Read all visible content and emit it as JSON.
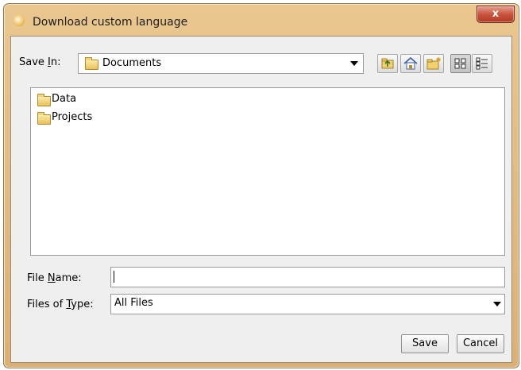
{
  "window": {
    "title": "Download custom language",
    "close_glyph": "x"
  },
  "save_in": {
    "label_prefix": "Save ",
    "label_mnemonic": "I",
    "label_suffix": "n:",
    "selected": "Documents",
    "icon": "folder-icon"
  },
  "toolbar": {
    "buttons": [
      {
        "name": "up-one-level",
        "icon": "folder-up-icon"
      },
      {
        "name": "home",
        "icon": "home-icon"
      },
      {
        "name": "new-folder",
        "icon": "new-folder-icon"
      },
      {
        "name": "list-view",
        "icon": "grid-view-icon",
        "active": true
      },
      {
        "name": "details-view",
        "icon": "details-view-icon",
        "active": false
      }
    ]
  },
  "files": [
    {
      "name": "Data",
      "icon": "folder-icon"
    },
    {
      "name": "Projects",
      "icon": "folder-icon"
    }
  ],
  "file_name": {
    "label_prefix": "File ",
    "label_mnemonic": "N",
    "label_suffix": "ame:",
    "value": ""
  },
  "file_type": {
    "label_prefix": "Files of ",
    "label_mnemonic": "T",
    "label_suffix": "ype:",
    "selected": "All Files"
  },
  "actions": {
    "save_label": "Save",
    "cancel_label": "Cancel"
  },
  "colors": {
    "title_bar": "#e3bd82",
    "close_button": "#c9543e",
    "dialog_background": "#efefef"
  }
}
